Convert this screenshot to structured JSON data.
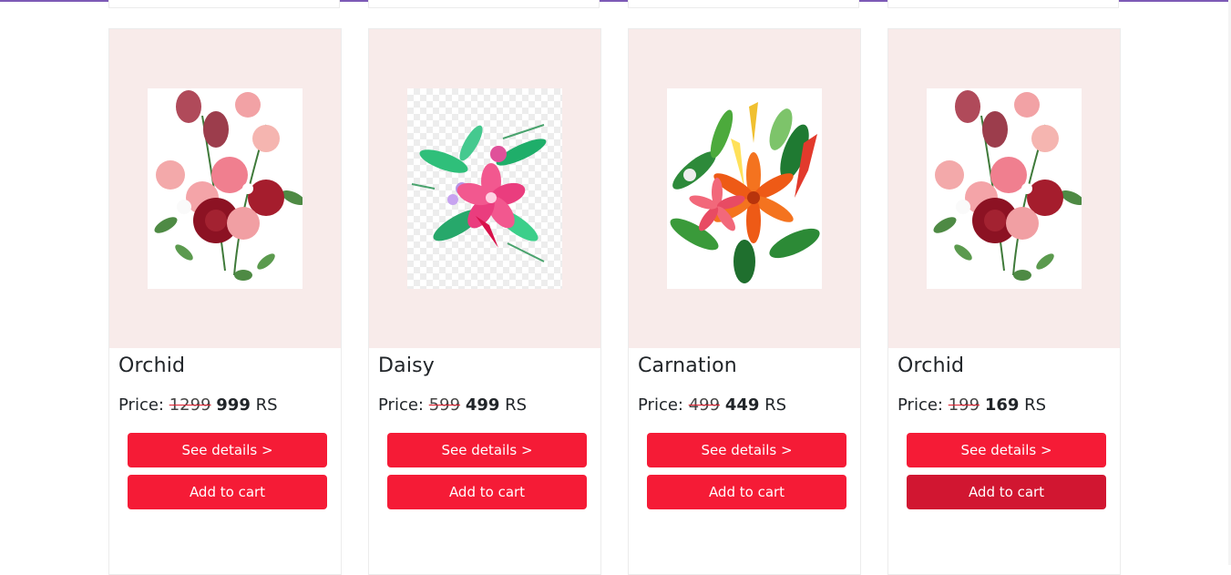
{
  "products": [
    {
      "name": "Orchid",
      "price_label": "Price:",
      "old_price": "1299",
      "new_price": "999",
      "currency": "RS",
      "details_label": "See details >",
      "cart_label": "Add to cart",
      "image": "rose-bouquet"
    },
    {
      "name": "Daisy",
      "price_label": "Price:",
      "old_price": "599",
      "new_price": "499",
      "currency": "RS",
      "details_label": "See details >",
      "cart_label": "Add to cart",
      "image": "tropical-pink-flower"
    },
    {
      "name": "Carnation",
      "price_label": "Price:",
      "old_price": "499",
      "new_price": "449",
      "currency": "RS",
      "details_label": "See details >",
      "cart_label": "Add to cart",
      "image": "tropical-bouquet"
    },
    {
      "name": "Orchid",
      "price_label": "Price:",
      "old_price": "199",
      "new_price": "169",
      "currency": "RS",
      "details_label": "See details >",
      "cart_label": "Add to cart",
      "image": "rose-bouquet"
    }
  ],
  "colors": {
    "card_image_bg": "#f8ebea",
    "button": "#f51b36",
    "button_hover": "#d11631",
    "strike": "#e0202e"
  }
}
